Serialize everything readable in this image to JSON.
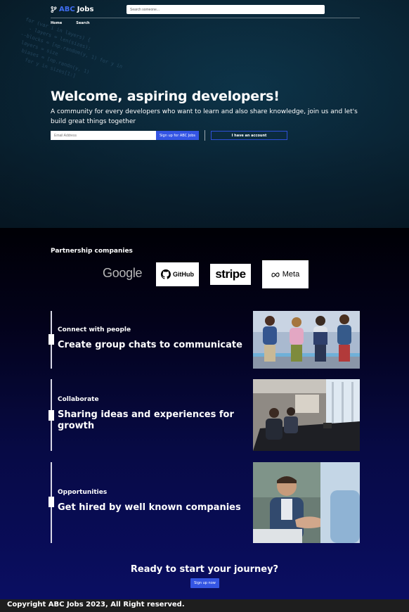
{
  "brand": {
    "prefix": "ABC",
    "suffix": "Jobs"
  },
  "search": {
    "placeholder": "Search someone..."
  },
  "nav": {
    "home": "Home",
    "search": "Search"
  },
  "hero": {
    "title": "Welcome, aspiring developers!",
    "subtitle": "A community for every developers who want to learn and also share knowledge, join us and let's build great things together",
    "email_placeholder": "Email Address",
    "signup_label": "Sign up for ABC Jobs",
    "account_label": "I have an account"
  },
  "partners": {
    "title": "Partnership companies",
    "logos": [
      "Google",
      "GitHub",
      "stripe",
      "Meta"
    ]
  },
  "features": [
    {
      "kicker": "Connect with people",
      "headline": "Create group chats to communicate"
    },
    {
      "kicker": "Collaborate",
      "headline": "Sharing ideas and experiences for growth"
    },
    {
      "kicker": "Opportunities",
      "headline": "Get hired by well known companies"
    }
  ],
  "cta": {
    "title": "Ready to start your journey?",
    "button": "Sign up now"
  },
  "footer": {
    "text": "Copyright ABC Jobs 2023, All Right reserved."
  },
  "colors": {
    "accent": "#3455e4",
    "brand_blue": "#3f6df0",
    "footer_bg": "#1e1e1e"
  }
}
